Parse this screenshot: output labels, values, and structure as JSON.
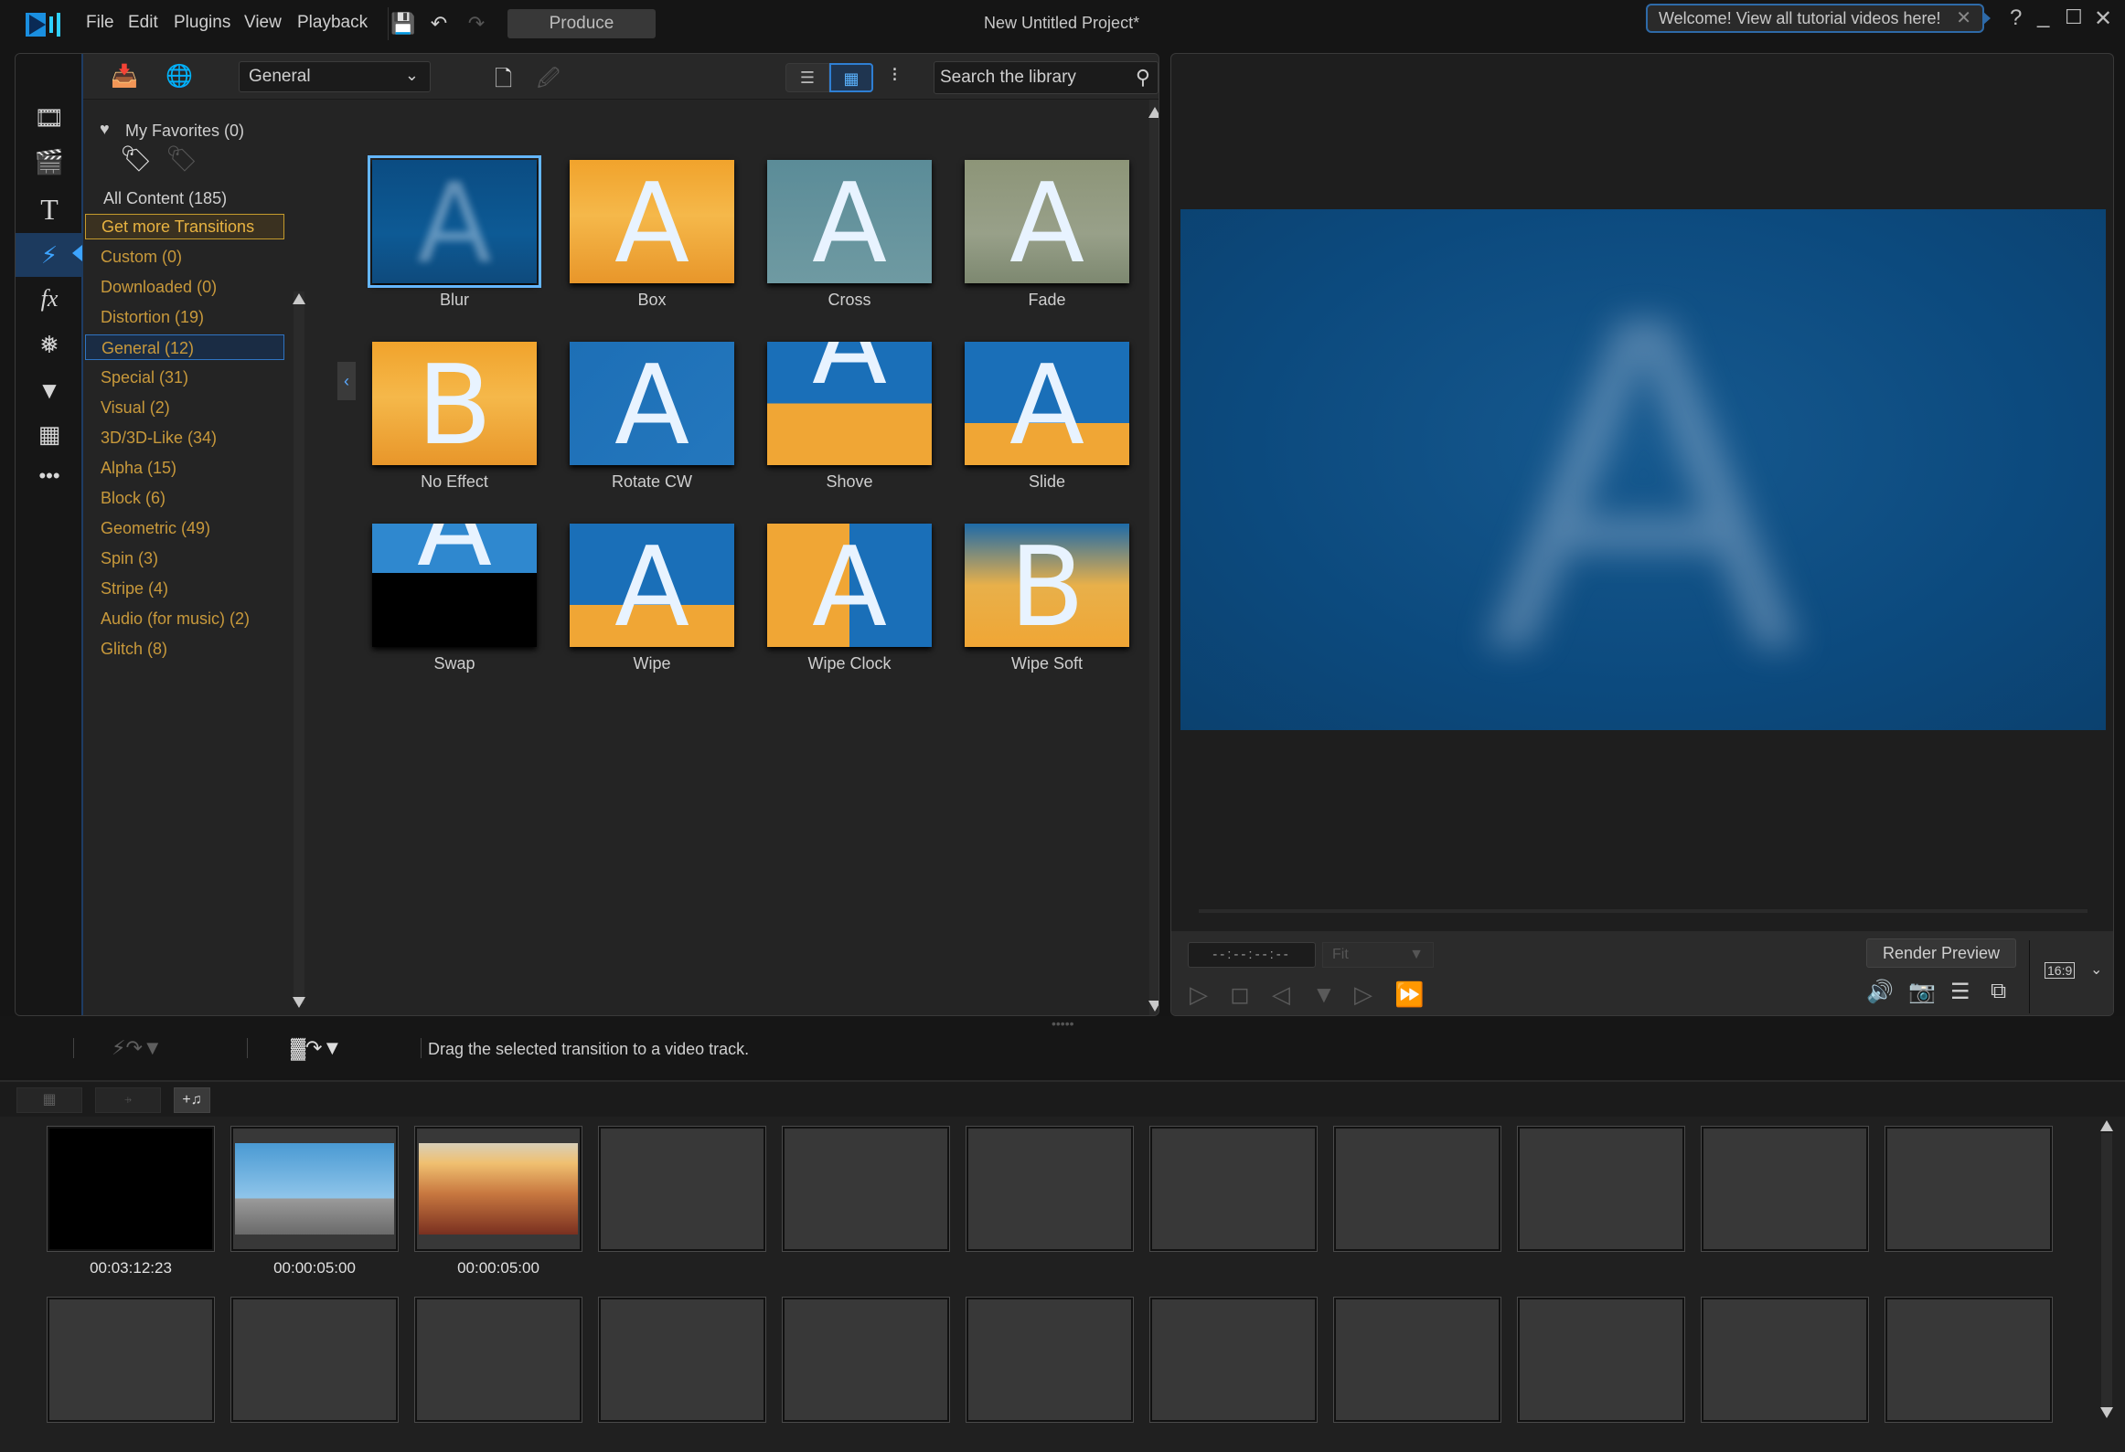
{
  "titlebar": {
    "menus": [
      "File",
      "Edit",
      "Plugins",
      "View",
      "Playback"
    ],
    "produce_label": "Produce",
    "project_title": "New Untitled Project*",
    "welcome_text": "Welcome! View all tutorial videos here!",
    "help": "?"
  },
  "library": {
    "category_dropdown": "General",
    "search_placeholder": "Search the library",
    "favorites_label": "My Favorites (0)",
    "all_content_label": "All Content (185)",
    "get_more_label": "Get more Transitions",
    "categories": [
      {
        "label": "Custom  (0)"
      },
      {
        "label": "Downloaded  (0)"
      },
      {
        "label": "Distortion  (19)"
      },
      {
        "label": "General  (12)",
        "selected": true
      },
      {
        "label": "Special  (31)"
      },
      {
        "label": "Visual  (2)"
      },
      {
        "label": "3D/3D-Like  (34)"
      },
      {
        "label": "Alpha  (15)"
      },
      {
        "label": "Block  (6)"
      },
      {
        "label": "Geometric  (49)"
      },
      {
        "label": "Spin  (3)"
      },
      {
        "label": "Stripe  (4)"
      },
      {
        "label": "Audio (for music)  (2)"
      },
      {
        "label": "Glitch  (8)"
      }
    ],
    "transitions": [
      {
        "label": "Blur",
        "selected": true
      },
      {
        "label": "Box"
      },
      {
        "label": "Cross"
      },
      {
        "label": "Fade"
      },
      {
        "label": "No Effect"
      },
      {
        "label": "Rotate CW"
      },
      {
        "label": "Shove"
      },
      {
        "label": "Slide"
      },
      {
        "label": "Swap"
      },
      {
        "label": "Wipe"
      },
      {
        "label": "Wipe Clock"
      },
      {
        "label": "Wipe Soft"
      }
    ]
  },
  "preview": {
    "timecode": "--:--:--:--",
    "zoom_select": "Fit",
    "render_label": "Render Preview",
    "aspect_ratio": "16:9"
  },
  "status": {
    "hint": "Drag the selected transition to a video track."
  },
  "storyboard": {
    "clips": [
      {
        "duration": "00:03:12:23",
        "kind": "black"
      },
      {
        "duration": "00:00:05:00",
        "kind": "skateboarder"
      },
      {
        "duration": "00:00:05:00",
        "kind": "canyon"
      }
    ],
    "slots_per_row": 11,
    "rows": 2
  },
  "colors": {
    "accent_blue": "#3da4ff",
    "category_gold": "#c8993b",
    "get_more_border": "#c49a2c"
  }
}
